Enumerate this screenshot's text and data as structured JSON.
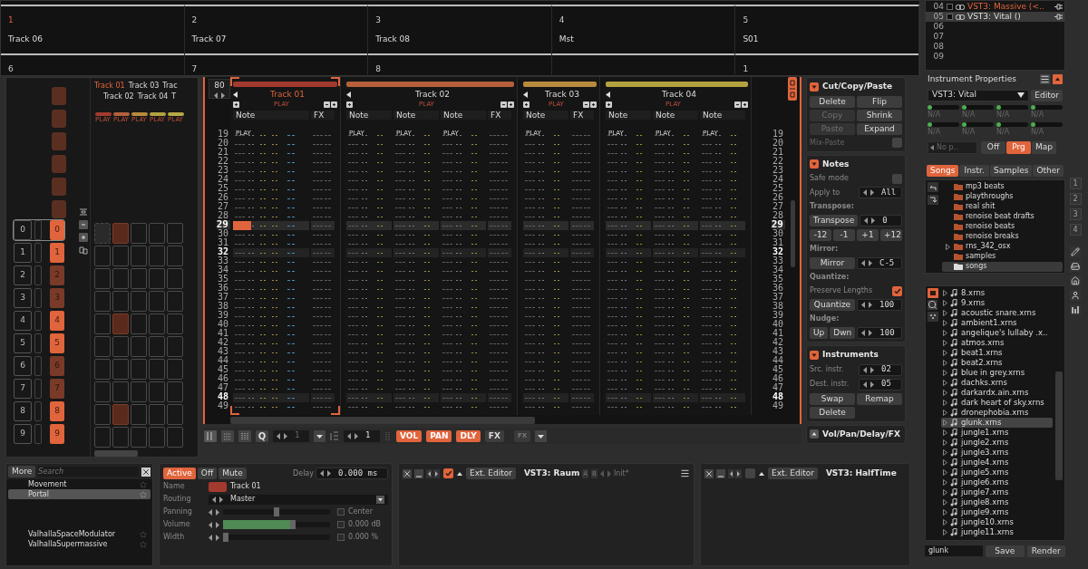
{
  "song_strip": {
    "columns": [
      {
        "number": "1",
        "selected": true,
        "name": "Track 06",
        "sub": "6"
      },
      {
        "number": "2",
        "selected": false,
        "name": "Track 07",
        "sub": "7"
      },
      {
        "number": "3",
        "selected": false,
        "name": "Track 08",
        "sub": "8"
      },
      {
        "number": "4",
        "selected": false,
        "name": "Mst"
      },
      {
        "number": "5",
        "selected": false,
        "name": "S01",
        "sub": "1"
      }
    ]
  },
  "instruments": [
    {
      "index": "04",
      "name": "VST3: Massive (<..",
      "selected": false,
      "accent": true
    },
    {
      "index": "05",
      "name": "VST3: Vital ()",
      "selected": true,
      "accent": false
    },
    {
      "index": "06",
      "selected": false
    },
    {
      "index": "07",
      "selected": false
    },
    {
      "index": "08",
      "selected": false
    },
    {
      "index": "09",
      "selected": false
    }
  ],
  "sequence": [
    {
      "slot": "0",
      "pattern": "0",
      "kind": "bright",
      "selected": true
    },
    {
      "slot": "1",
      "pattern": "1",
      "kind": "bright",
      "selected": false
    },
    {
      "slot": "2",
      "pattern": "2",
      "kind": "dim",
      "selected": false
    },
    {
      "slot": "3",
      "pattern": "3",
      "kind": "dim",
      "selected": false
    },
    {
      "slot": "4",
      "pattern": "4",
      "kind": "bright",
      "selected": false
    },
    {
      "slot": "5",
      "pattern": "5",
      "kind": "bright",
      "selected": false
    },
    {
      "slot": "6",
      "pattern": "6",
      "kind": "dim",
      "selected": false
    },
    {
      "slot": "7",
      "pattern": "7",
      "kind": "dim",
      "selected": false
    },
    {
      "slot": "8",
      "pattern": "8",
      "kind": "bright",
      "selected": false
    },
    {
      "slot": "9",
      "pattern": "9",
      "kind": "bright",
      "selected": false
    }
  ],
  "matrix": {
    "labels": [
      {
        "name": "Track 01",
        "selected": true
      },
      {
        "name": "Track 02",
        "selected": false
      },
      {
        "name": "Track 03",
        "selected": false
      },
      {
        "name": "Track 04",
        "selected": false
      },
      {
        "name": "Trac",
        "selected": false
      },
      {
        "name": "T",
        "selected": false
      }
    ],
    "tracks": [
      {
        "color": "#a33a2e",
        "state": "PLAY"
      },
      {
        "color": "#b5603a",
        "state": "PLAY"
      },
      {
        "color": "#b88a3c",
        "state": "PLAY"
      },
      {
        "color": "#b3a23e",
        "state": "PLAY"
      },
      {
        "color": "#b8a844",
        "state": "PLAY"
      }
    ],
    "rows": [
      [
        {
          "filled": false,
          "selected": true
        },
        {
          "filled": true,
          "selected": false
        },
        {
          "filled": false,
          "selected": false
        },
        {
          "filled": false,
          "selected": false
        },
        {
          "filled": false,
          "selected": false
        }
      ],
      [
        {
          "filled": false,
          "selected": false
        },
        {
          "filled": false,
          "selected": false
        },
        {
          "filled": false,
          "selected": false
        },
        {
          "filled": false,
          "selected": false
        },
        {
          "filled": false,
          "selected": false
        }
      ],
      [
        {
          "filled": false,
          "selected": false
        },
        {
          "filled": false,
          "selected": false
        },
        {
          "filled": false,
          "selected": false
        },
        {
          "filled": false,
          "selected": false
        },
        {
          "filled": false,
          "selected": false
        }
      ],
      [
        {
          "filled": false,
          "selected": false
        },
        {
          "filled": false,
          "selected": false
        },
        {
          "filled": false,
          "selected": false
        },
        {
          "filled": false,
          "selected": false
        },
        {
          "filled": false,
          "selected": false
        }
      ],
      [
        {
          "filled": false,
          "selected": false
        },
        {
          "filled": true,
          "selected": false
        },
        {
          "filled": false,
          "selected": false
        },
        {
          "filled": false,
          "selected": false
        },
        {
          "filled": false,
          "selected": false
        }
      ],
      [
        {
          "filled": false,
          "selected": false
        },
        {
          "filled": false,
          "selected": false
        },
        {
          "filled": false,
          "selected": false
        },
        {
          "filled": false,
          "selected": false
        },
        {
          "filled": false,
          "selected": false
        }
      ],
      [
        {
          "filled": false,
          "selected": false
        },
        {
          "filled": false,
          "selected": false
        },
        {
          "filled": false,
          "selected": false
        },
        {
          "filled": false,
          "selected": false
        },
        {
          "filled": false,
          "selected": false
        }
      ],
      [
        {
          "filled": false,
          "selected": false
        },
        {
          "filled": false,
          "selected": false
        },
        {
          "filled": false,
          "selected": false
        },
        {
          "filled": false,
          "selected": false
        },
        {
          "filled": false,
          "selected": false
        }
      ],
      [
        {
          "filled": false,
          "selected": false
        },
        {
          "filled": true,
          "selected": false
        },
        {
          "filled": false,
          "selected": false
        },
        {
          "filled": false,
          "selected": false
        },
        {
          "filled": false,
          "selected": false
        }
      ],
      [
        {
          "filled": false,
          "selected": false
        },
        {
          "filled": false,
          "selected": false
        },
        {
          "filled": false,
          "selected": false
        },
        {
          "filled": false,
          "selected": false
        },
        {
          "filled": false,
          "selected": false
        }
      ]
    ]
  },
  "pattern": {
    "lines": "80",
    "tracks": [
      {
        "name": "Track 01",
        "color": "#a33a2e",
        "selected": true,
        "state": "PLAY",
        "columns": [
          {
            "label": "Note",
            "kind": "note_ext",
            "state": "PLAY"
          },
          {
            "label": "FX",
            "kind": "fx"
          }
        ]
      },
      {
        "name": "Track 02",
        "color": "#b5603a",
        "selected": false,
        "state": "PLAY",
        "columns": [
          {
            "label": "Note",
            "kind": "note",
            "state": "PLAY"
          },
          {
            "label": "Note",
            "kind": "note",
            "state": "PLAY"
          },
          {
            "label": "Note",
            "kind": "note",
            "state": "PLAY"
          },
          {
            "label": "FX",
            "kind": "fx"
          }
        ]
      },
      {
        "name": "Track 03",
        "color": "#b88a3c",
        "selected": false,
        "state": "PLAY",
        "columns": [
          {
            "label": "Note",
            "kind": "note",
            "state": "PLAY"
          },
          {
            "label": "FX",
            "kind": "fx"
          }
        ]
      },
      {
        "name": "Track 04",
        "color": "#b3a23e",
        "selected": false,
        "state": "PLAY",
        "columns": [
          {
            "label": "Note",
            "kind": "note",
            "state": "PLAY"
          },
          {
            "label": "Note",
            "kind": "note",
            "state": "PLAY"
          },
          {
            "label": "Note",
            "kind": "note",
            "state": "PLAY"
          }
        ]
      }
    ],
    "line_numbers_left": [
      {
        "n": "19",
        "kind": "normal"
      },
      {
        "n": "20",
        "kind": "normal"
      },
      {
        "n": "21",
        "kind": "normal"
      },
      {
        "n": "22",
        "kind": "normal"
      },
      {
        "n": "23",
        "kind": "normal"
      },
      {
        "n": "24",
        "kind": "normal"
      },
      {
        "n": "25",
        "kind": "normal"
      },
      {
        "n": "26",
        "kind": "normal"
      },
      {
        "n": "27",
        "kind": "normal"
      },
      {
        "n": "28",
        "kind": "normal"
      },
      {
        "n": "29",
        "kind": "current"
      },
      {
        "n": "30",
        "kind": "normal"
      },
      {
        "n": "31",
        "kind": "normal"
      },
      {
        "n": "32",
        "kind": "beat"
      },
      {
        "n": "33",
        "kind": "normal"
      },
      {
        "n": "34",
        "kind": "normal"
      },
      {
        "n": "35",
        "kind": "normal"
      },
      {
        "n": "36",
        "kind": "normal"
      },
      {
        "n": "37",
        "kind": "normal"
      },
      {
        "n": "38",
        "kind": "normal"
      },
      {
        "n": "39",
        "kind": "normal"
      },
      {
        "n": "40",
        "kind": "normal"
      },
      {
        "n": "41",
        "kind": "normal"
      },
      {
        "n": "42",
        "kind": "normal"
      },
      {
        "n": "43",
        "kind": "normal"
      },
      {
        "n": "44",
        "kind": "normal"
      },
      {
        "n": "45",
        "kind": "normal"
      },
      {
        "n": "46",
        "kind": "normal"
      },
      {
        "n": "47",
        "kind": "normal"
      },
      {
        "n": "48",
        "kind": "beat"
      },
      {
        "n": "49",
        "kind": "normal"
      }
    ],
    "line_numbers_right": [
      {
        "n": "19",
        "kind": "normal"
      },
      {
        "n": "20",
        "kind": "normal"
      },
      {
        "n": "21",
        "kind": "normal"
      },
      {
        "n": "22",
        "kind": "normal"
      },
      {
        "n": "23",
        "kind": "normal"
      },
      {
        "n": "24",
        "kind": "normal"
      },
      {
        "n": "25",
        "kind": "normal"
      },
      {
        "n": "26",
        "kind": "normal"
      },
      {
        "n": "27",
        "kind": "normal"
      },
      {
        "n": "28",
        "kind": "normal"
      },
      {
        "n": "29",
        "kind": "current"
      },
      {
        "n": "30",
        "kind": "normal"
      },
      {
        "n": "31",
        "kind": "normal"
      },
      {
        "n": "32",
        "kind": "beat"
      },
      {
        "n": "33",
        "kind": "normal"
      },
      {
        "n": "34",
        "kind": "normal"
      },
      {
        "n": "35",
        "kind": "normal"
      },
      {
        "n": "36",
        "kind": "normal"
      },
      {
        "n": "37",
        "kind": "normal"
      },
      {
        "n": "38",
        "kind": "normal"
      },
      {
        "n": "39",
        "kind": "normal"
      },
      {
        "n": "40",
        "kind": "normal"
      },
      {
        "n": "41",
        "kind": "normal"
      },
      {
        "n": "42",
        "kind": "normal"
      },
      {
        "n": "43",
        "kind": "normal"
      },
      {
        "n": "44",
        "kind": "normal"
      },
      {
        "n": "45",
        "kind": "normal"
      },
      {
        "n": "46",
        "kind": "normal"
      },
      {
        "n": "47",
        "kind": "normal"
      },
      {
        "n": "48",
        "kind": "beat"
      },
      {
        "n": "49",
        "kind": "normal"
      }
    ]
  },
  "pattern_toolbar": {
    "quantize": "Q",
    "quantize_value": "1",
    "step": "1",
    "toggles": [
      {
        "label": "VOL",
        "on": true
      },
      {
        "label": "PAN",
        "on": true
      },
      {
        "label": "DLY",
        "on": true
      },
      {
        "label": "FX",
        "on": false
      }
    ],
    "fx_column": "FX"
  },
  "tools": [
    {
      "title": "Cut/Copy/Paste",
      "expanded": true,
      "items": [
        {
          "kind": "buttons",
          "buttons": [
            {
              "label": "Delete",
              "disabled": false
            },
            {
              "label": "Flip",
              "disabled": false
            },
            {
              "label": "Copy",
              "disabled": true
            },
            {
              "label": "Shrink",
              "disabled": false
            },
            {
              "label": "Paste",
              "disabled": true
            },
            {
              "label": "Expand",
              "disabled": false
            }
          ]
        },
        {
          "kind": "check",
          "label": "Mix-Paste",
          "checked": false,
          "disabled": true
        }
      ]
    },
    {
      "title": "Notes",
      "expanded": true,
      "items": [
        {
          "kind": "check",
          "label": "Safe mode",
          "checked": false,
          "disabled": false
        },
        {
          "kind": "value",
          "label": "Apply to",
          "value": "All"
        },
        {
          "kind": "heading",
          "label": "Transpose:"
        },
        {
          "kind": "button-value",
          "buttons": [
            {
              "label": "Transpose",
              "disabled": false
            }
          ],
          "value": "0"
        },
        {
          "kind": "buttons",
          "buttons": [
            {
              "label": "-12",
              "disabled": false
            },
            {
              "label": "-1",
              "disabled": false
            },
            {
              "label": "+1",
              "disabled": false
            },
            {
              "label": "+12",
              "disabled": false
            }
          ]
        },
        {
          "kind": "heading",
          "label": "Mirror:"
        },
        {
          "kind": "button-value",
          "buttons": [
            {
              "label": "Mirror",
              "disabled": false
            }
          ],
          "value": "C-5"
        },
        {
          "kind": "heading",
          "label": "Quantize:"
        },
        {
          "kind": "check",
          "label": "Preserve Lengths",
          "checked": true,
          "disabled": false
        },
        {
          "kind": "button-value",
          "buttons": [
            {
              "label": "Quantize",
              "disabled": false
            }
          ],
          "value": "100"
        },
        {
          "kind": "heading",
          "label": "Nudge:"
        },
        {
          "kind": "button-value",
          "buttons": [
            {
              "label": "Up",
              "disabled": false
            },
            {
              "label": "Dwn",
              "disabled": false
            }
          ],
          "value": "100"
        }
      ]
    },
    {
      "title": "Instruments",
      "expanded": true,
      "items": [
        {
          "kind": "value",
          "label": "Src. instr.",
          "value": "02"
        },
        {
          "kind": "value",
          "label": "Dest. instr.",
          "value": "05"
        },
        {
          "kind": "buttons",
          "buttons": [
            {
              "label": "Swap",
              "disabled": false
            },
            {
              "label": "Remap",
              "disabled": false
            },
            {
              "label": "Delete",
              "disabled": false
            }
          ]
        }
      ]
    },
    {
      "title": "Vol/Pan/Delay/FX",
      "expanded": false
    }
  ],
  "instrument_properties": {
    "title": "Instrument Properties",
    "plugin": "VST3: Vital",
    "editor": "Editor",
    "params": [
      {
        "label": "N/A",
        "level": 0
      },
      {
        "label": "N/A",
        "level": 0
      },
      {
        "label": "N/A",
        "level": 0
      },
      {
        "label": "N/A",
        "level": 0
      },
      {
        "label": "N/A",
        "level": 0
      },
      {
        "label": "N/A",
        "level": 0
      },
      {
        "label": "N/A",
        "level": 0
      },
      {
        "label": "N/A",
        "level": 0
      }
    ],
    "preset": "No p..",
    "modes": [
      {
        "label": "Off",
        "selected": false
      },
      {
        "label": "Prg",
        "selected": true
      },
      {
        "label": "Map",
        "selected": false
      }
    ]
  },
  "browser": {
    "tabs": [
      {
        "label": "Songs",
        "selected": true
      },
      {
        "label": "Instr.",
        "selected": false
      },
      {
        "label": "Samples",
        "selected": false
      },
      {
        "label": "Other",
        "selected": false
      }
    ],
    "folders": [
      {
        "name": "mp3 beats",
        "selected": false,
        "expandable": false
      },
      {
        "name": "playthroughs",
        "selected": false,
        "expandable": false
      },
      {
        "name": "real shit",
        "selected": false,
        "expandable": false
      },
      {
        "name": "renoise beat drafts",
        "selected": false,
        "expandable": false
      },
      {
        "name": "renoise beats",
        "selected": false,
        "expandable": false
      },
      {
        "name": "renoise breaks",
        "selected": false,
        "expandable": false
      },
      {
        "name": "rns_342_osx",
        "selected": false,
        "expandable": true
      },
      {
        "name": "samples",
        "selected": false,
        "expandable": false
      },
      {
        "name": "songs",
        "selected": true,
        "expandable": false
      }
    ],
    "files": [
      {
        "name": "8.xrns",
        "selected": false
      },
      {
        "name": "9.xrns",
        "selected": false
      },
      {
        "name": "acoustic snare.xrns",
        "selected": false
      },
      {
        "name": "ambient1.xrns",
        "selected": false
      },
      {
        "name": "angelique's lullaby .x..",
        "selected": false
      },
      {
        "name": "atmos.xrns",
        "selected": false
      },
      {
        "name": "beat1.xrns",
        "selected": false
      },
      {
        "name": "beat2.xrns",
        "selected": false
      },
      {
        "name": "blue in grey.xrns",
        "selected": false
      },
      {
        "name": "dachks.xrns",
        "selected": false
      },
      {
        "name": "darkardx.ain.xrns",
        "selected": false
      },
      {
        "name": "dark heart of sky.xrns",
        "selected": false
      },
      {
        "name": "dronephobia.xrns",
        "selected": false
      },
      {
        "name": "glunk.xrns",
        "selected": true
      },
      {
        "name": "jungle1.xrns",
        "selected": false
      },
      {
        "name": "jungle2.xrns",
        "selected": false
      },
      {
        "name": "jungle3.xrns",
        "selected": false
      },
      {
        "name": "jungle4.xrns",
        "selected": false
      },
      {
        "name": "jungle5.xrns",
        "selected": false
      },
      {
        "name": "jungle6.xrns",
        "selected": false
      },
      {
        "name": "jungle7.xrns",
        "selected": false
      },
      {
        "name": "jungle8.xrns",
        "selected": false
      },
      {
        "name": "jungle9.xrns",
        "selected": false
      },
      {
        "name": "jungle10.xrns",
        "selected": false
      },
      {
        "name": "jungle11.xrns",
        "selected": false
      }
    ],
    "search": "glunk",
    "buttons": [
      "Save",
      "Render"
    ]
  },
  "side_buttons": [
    "1",
    "2",
    "3",
    "4"
  ],
  "dsp_list": {
    "more": "More",
    "search_placeholder": "Search",
    "items": [
      {
        "name": "Movement",
        "selected": false
      },
      {
        "name": "Portal",
        "selected": true
      },
      {
        "name": "ValhallaSpaceModulator",
        "selected": false
      },
      {
        "name": "ValhallaSupermassive",
        "selected": false
      }
    ]
  },
  "track_dsp": {
    "modes": [
      {
        "label": "Active",
        "selected": true
      },
      {
        "label": "Off",
        "selected": false
      },
      {
        "label": "Mute",
        "selected": false
      }
    ],
    "delay_label": "Delay",
    "delay": "0.000 ms",
    "fields": [
      {
        "label": "Name",
        "kind": "name",
        "value": "Track 01",
        "color": "#a33a2e"
      },
      {
        "label": "Routing",
        "kind": "dropdown",
        "value": "Master"
      },
      {
        "label": "Panning",
        "kind": "slider",
        "level": 0.5,
        "checked": false,
        "reading": "Center"
      },
      {
        "label": "Volume",
        "kind": "fader",
        "level": 0.68,
        "checked": false,
        "reading": "0.000 dB"
      },
      {
        "label": "Width",
        "kind": "slider",
        "level": 0,
        "checked": false,
        "reading": "0.000 %"
      }
    ]
  },
  "devices": [
    {
      "name": "VST3: Raum",
      "enabled": true,
      "ext": "Ext. Editor",
      "ab": [
        "A",
        "B"
      ],
      "preset": "Init*"
    },
    {
      "name": "VST3: HalfTime",
      "enabled": false,
      "ext": "Ext. Editor"
    }
  ]
}
